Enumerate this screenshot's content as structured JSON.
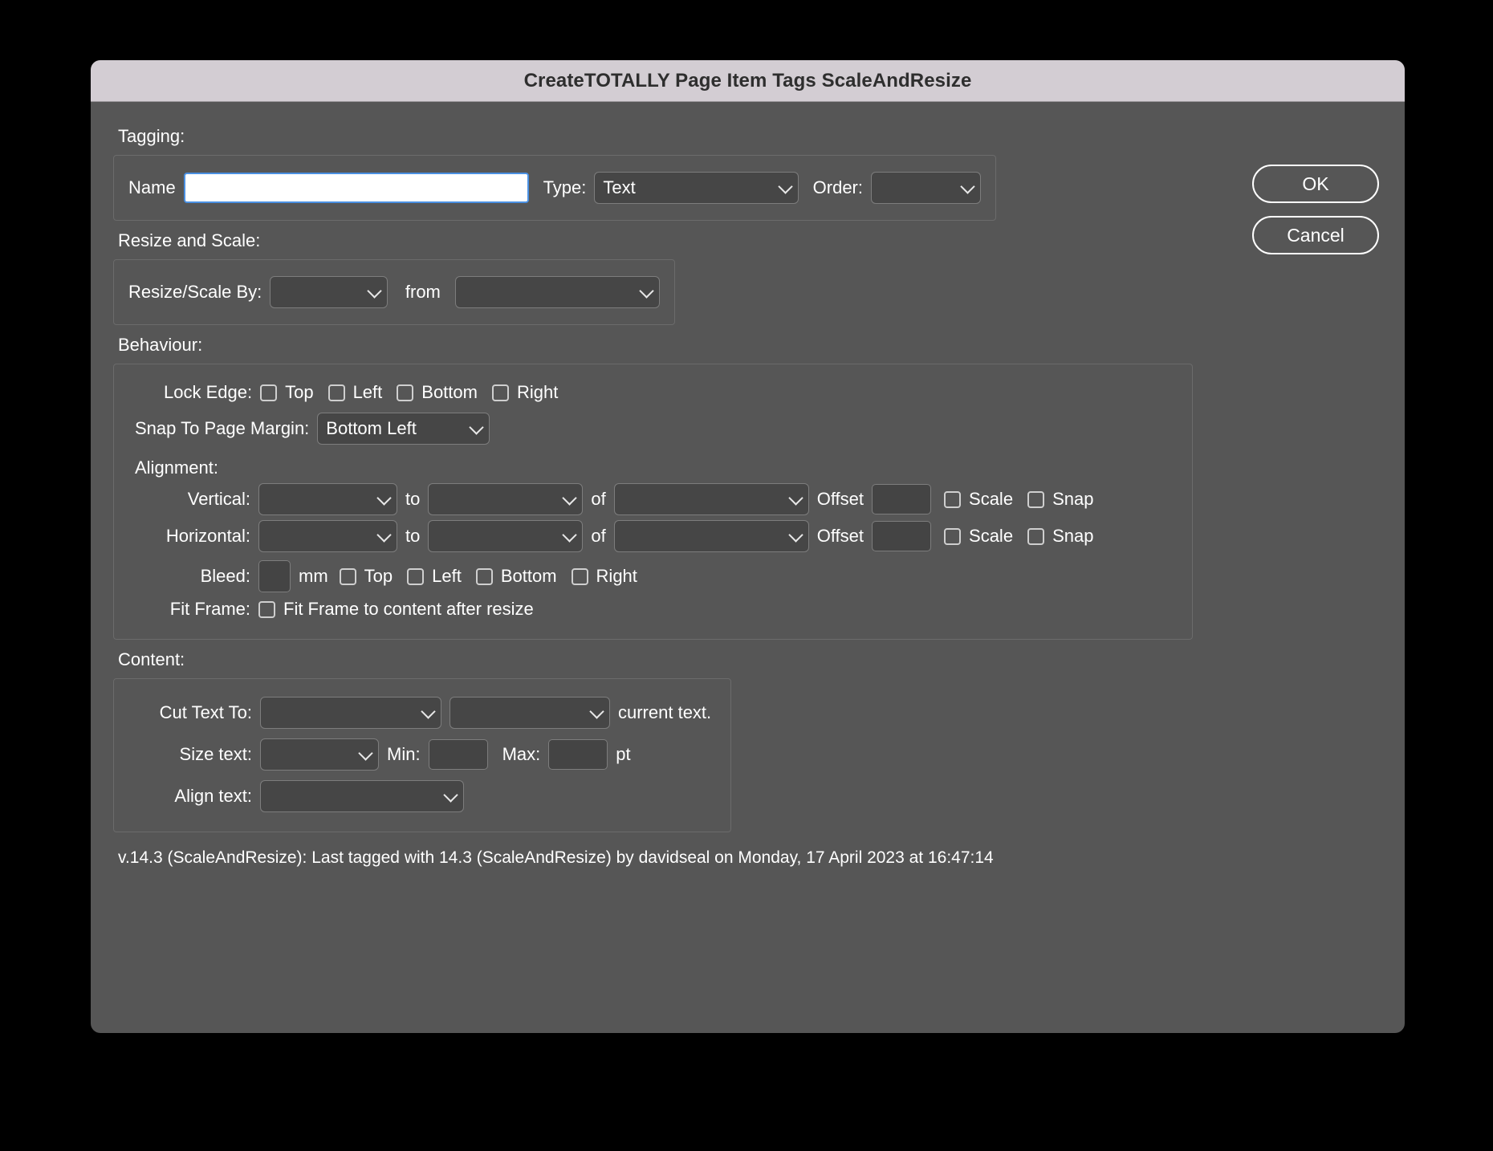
{
  "window": {
    "title": "CreateTOTALLY Page Item Tags ScaleAndResize"
  },
  "buttons": {
    "ok": "OK",
    "cancel": "Cancel"
  },
  "tagging": {
    "section_label": "Tagging:",
    "name_label": "Name",
    "name_value": "",
    "name_placeholder": "",
    "type_label": "Type:",
    "type_value": "Text",
    "order_label": "Order:",
    "order_value": ""
  },
  "resize_and_scale": {
    "section_label": "Resize and Scale:",
    "resize_scale_by_label": "Resize/Scale By:",
    "resize_scale_by_value": "",
    "from_label": "from",
    "from_value": ""
  },
  "behaviour": {
    "section_label": "Behaviour:",
    "lock_edge_label": "Lock Edge:",
    "lock_edge_options": [
      "Top",
      "Left",
      "Bottom",
      "Right"
    ],
    "snap_margin_label": "Snap To Page Margin:",
    "snap_margin_value": "Bottom Left",
    "alignment_label": "Alignment:",
    "vertical_label": "Vertical:",
    "horizontal_label": "Horizontal:",
    "to_label": "to",
    "of_label": "of",
    "offset_label": "Offset",
    "scale_label": "Scale",
    "snap_label": "Snap",
    "vertical": {
      "align_value": "",
      "to_value": "",
      "of_value": "",
      "offset_value": "",
      "scale_checked": false,
      "snap_checked": false
    },
    "horizontal": {
      "align_value": "",
      "to_value": "",
      "of_value": "",
      "offset_value": "",
      "scale_checked": false,
      "snap_checked": false
    },
    "bleed_label": "Bleed:",
    "bleed_value": "",
    "bleed_unit": "mm",
    "bleed_options": [
      "Top",
      "Left",
      "Bottom",
      "Right"
    ],
    "fit_frame_label": "Fit Frame:",
    "fit_frame_option": "Fit Frame to content after resize"
  },
  "content": {
    "section_label": "Content:",
    "cut_text_to_label": "Cut Text To:",
    "cut_text_to_value": "",
    "cut_text_scope_value": "",
    "current_text_label": "current text.",
    "size_text_label": "Size text:",
    "size_text_value": "",
    "min_label": "Min:",
    "min_value": "",
    "max_label": "Max:",
    "max_value": "",
    "pt_label": "pt",
    "align_text_label": "Align text:",
    "align_text_value": ""
  },
  "status": {
    "text": "v.14.3 (ScaleAndResize):   Last tagged with 14.3 (ScaleAndResize) by davidseal  on Monday, 17 April 2023 at 16:47:14"
  },
  "colors": {
    "dialog_bg": "#565656",
    "titlebar_bg": "#d3cdd3",
    "focus_border": "#4a90e2",
    "control_bg": "#464646"
  }
}
